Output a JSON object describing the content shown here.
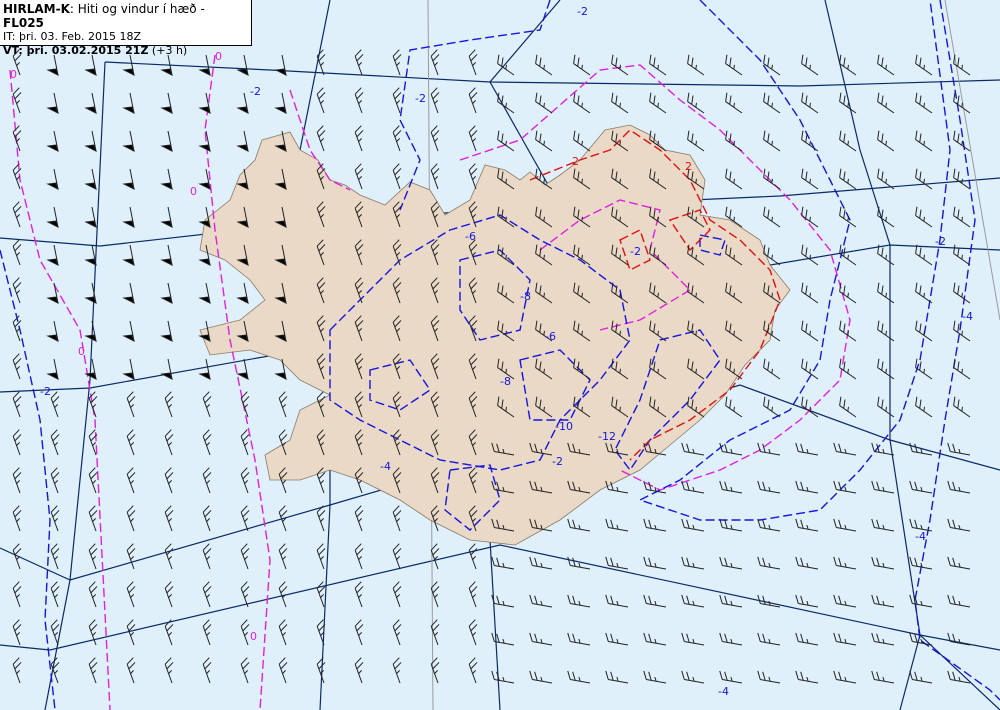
{
  "header": {
    "model": "HIRLAM-K",
    "title_sep": ": ",
    "description": "Hiti og vindur í hæð - ",
    "level": "FL025",
    "initial_time_label": "IT: ",
    "initial_time": "þri. 03. Feb. 2015 18Z",
    "valid_time_label": "VT: ",
    "valid_time": "þri. 03.02.2015 21Z",
    "lead": " (+3 h)"
  },
  "colors": {
    "sea": "#dff0fb",
    "land": "#e9d9c6",
    "grid": "#0a2a66",
    "meridian": "#9a9a9a",
    "contour_negative": "#1515dd",
    "contour_zero": "#e020e0",
    "contour_positive": "#e01010"
  },
  "contour_labels": [
    "0",
    "0",
    "0",
    "0",
    "0",
    "-2",
    "-2",
    "-2",
    "-2",
    "-2",
    "-2",
    "-4",
    "-4",
    "-4",
    "-6",
    "-6",
    "-8",
    "-8",
    "-10",
    "-12",
    "2",
    "2",
    "-2",
    "-4"
  ]
}
